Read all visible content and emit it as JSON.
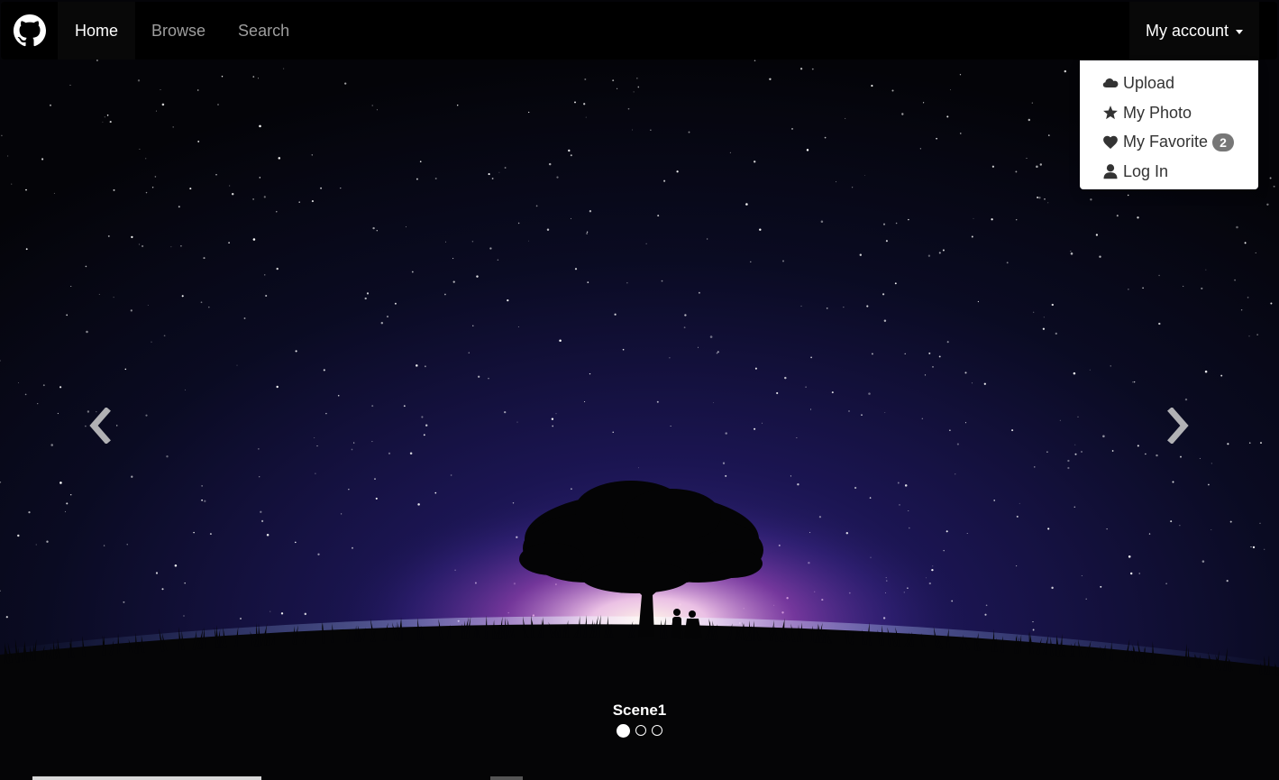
{
  "navbar": {
    "brand_icon": "github-icon",
    "links": [
      {
        "label": "Home",
        "active": true
      },
      {
        "label": "Browse",
        "active": false
      },
      {
        "label": "Search",
        "active": false
      }
    ],
    "account": {
      "label": "My account",
      "dropdown_open": true,
      "items": [
        {
          "label": "Upload",
          "icon": "cloud-icon"
        },
        {
          "label": "My Photo",
          "icon": "star-icon"
        },
        {
          "label": "My Favorite",
          "icon": "heart-icon",
          "badge": "2"
        },
        {
          "label": "Log In",
          "icon": "user-icon"
        }
      ]
    }
  },
  "carousel": {
    "caption": "Scene1",
    "slide_count": 3,
    "active_index": 0,
    "prev_icon": "chevron-left-icon",
    "next_icon": "chevron-right-icon"
  },
  "colors": {
    "navbar_bg": "#000000",
    "nav_link": "#9d9d9d",
    "nav_active": "#ffffff",
    "badge_bg": "#777777",
    "dropdown_text": "#333333"
  }
}
